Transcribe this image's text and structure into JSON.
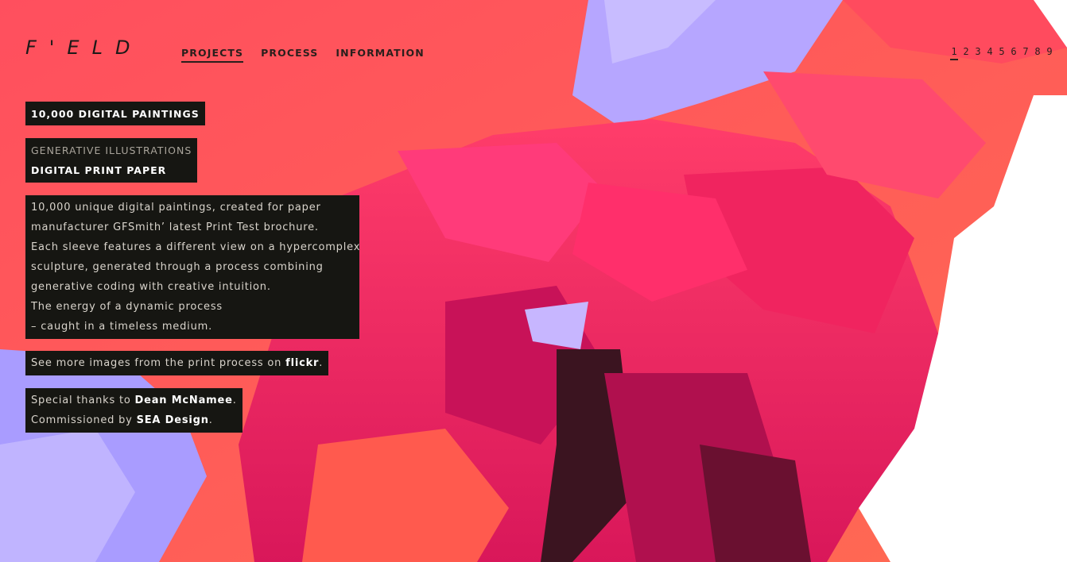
{
  "site": {
    "logo": "F'ELD"
  },
  "nav": {
    "items": [
      "PROJECTS",
      "PROCESS",
      "INFORMATION"
    ],
    "active": "PROJECTS"
  },
  "pager": {
    "pages": [
      "1",
      "2",
      "3",
      "4",
      "5",
      "6",
      "7",
      "8",
      "9"
    ],
    "active": "1"
  },
  "project": {
    "title": "10,000 DIGITAL PAINTINGS",
    "categories": [
      "GENERATIVE ILLUSTRATIONS",
      "DIGITAL PRINT PAPER"
    ],
    "description": [
      "10,000 unique digital paintings, created for paper",
      "manufacturer GFSmith’ latest Print Test brochure.",
      "Each sleeve features a different view on a hypercomplex",
      "sculpture, generated through a process combining",
      "generative coding with creative intuition.",
      "The energy of a dynamic process",
      "– caught in a timeless medium."
    ],
    "flickr": {
      "prefix": "See more images from the print process on ",
      "link": "flickr",
      "suffix": "."
    },
    "thanks": {
      "prefix": "Special thanks to ",
      "link": "Dean McNamee",
      "suffix": "."
    },
    "commission": {
      "prefix": "Commissioned by ",
      "link": "SEA Design",
      "suffix": "."
    }
  },
  "colors": {
    "panel": "#161612",
    "coral": "#ff5a5f",
    "magenta": "#e8235f",
    "lavender": "#a9a1ff"
  }
}
